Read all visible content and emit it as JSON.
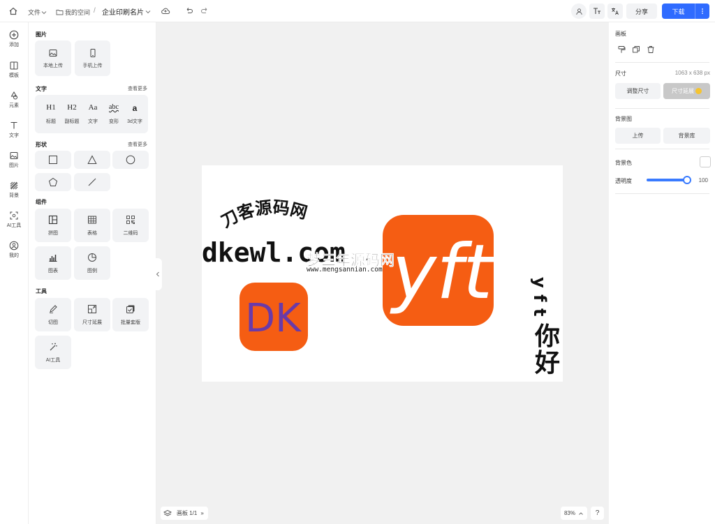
{
  "topbar": {
    "file_menu": "文件",
    "my_space": "我的空间",
    "separator": "/",
    "doc_title": "企业印刷名片",
    "share_label": "分享",
    "download_label": "下载"
  },
  "rail": {
    "items": [
      {
        "label": "添加",
        "icon": "plus-circle-icon"
      },
      {
        "label": "模板",
        "icon": "template-icon"
      },
      {
        "label": "元素",
        "icon": "shapes-icon"
      },
      {
        "label": "文字",
        "icon": "text-icon"
      },
      {
        "label": "图片",
        "icon": "image-icon"
      },
      {
        "label": "背景",
        "icon": "background-icon"
      },
      {
        "label": "AI工具",
        "icon": "ai-scan-icon"
      },
      {
        "label": "我的",
        "icon": "user-circle-icon"
      }
    ]
  },
  "panel": {
    "image_section": "图片",
    "image_items": [
      "本地上传",
      "手机上传"
    ],
    "text_section": "文字",
    "text_more": "查看更多",
    "text_glyphs": [
      "H1",
      "H2",
      "Aa",
      "abc",
      "a"
    ],
    "text_items": [
      "标题",
      "副标题",
      "文字",
      "变形",
      "3d文字"
    ],
    "shape_section": "形状",
    "shape_more": "查看更多",
    "component_section": "组件",
    "component_items": [
      "拼图",
      "表格",
      "二维码",
      "图表",
      "图例"
    ],
    "tool_section": "工具",
    "tool_items": [
      "切图",
      "尺寸延展",
      "批量套版",
      "AI工具"
    ]
  },
  "canvas": {
    "arc_text": "刀客源码网",
    "domain_text": "dkewl.com",
    "watermark_cn": "梦三年源码网",
    "watermark_en": "www.mengsannian.com",
    "logo_dk": "DK",
    "logo_yft": "yft",
    "vertical_text_chars": [
      "y",
      "f",
      "t",
      "你",
      "好"
    ],
    "brand_orange": "#f55d13",
    "dk_purple": "#6a3aa8"
  },
  "bottom": {
    "board_label": "画板 1/1",
    "board_expand": "»",
    "zoom": "83%",
    "help": "?"
  },
  "right": {
    "artboard_title": "画板",
    "size_label": "尺寸",
    "size_value": "1063 x 638 px",
    "adjust_size": "调整尺寸",
    "size_extend": "尺寸延展",
    "bg_image_label": "背景图",
    "upload": "上传",
    "bg_library": "背景库",
    "bg_color_label": "背景色",
    "opacity_label": "透明度",
    "opacity_value": "100",
    "opacity_fraction": 1.0
  },
  "colors": {
    "primary": "#2f6bff",
    "disabled_btn": "#c8c8c8"
  }
}
